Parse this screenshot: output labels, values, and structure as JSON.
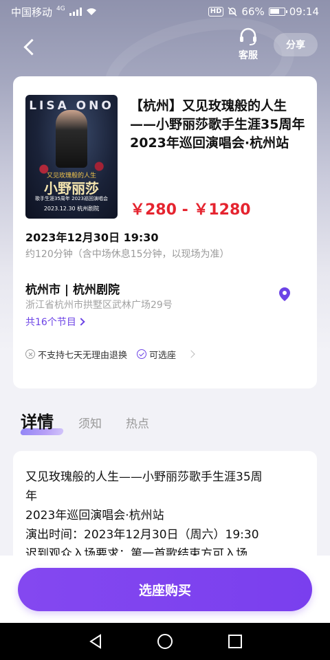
{
  "status_bar": {
    "carrier": "中国移动",
    "network": "4G",
    "hd": "HD",
    "battery": "66%",
    "time": "09:14"
  },
  "nav": {
    "service_label": "客服",
    "share_label": "分享"
  },
  "event": {
    "poster_artist": "LISA ONO",
    "poster_subtitle": "又见玫瑰般的人生",
    "poster_name": "小野丽莎",
    "poster_line": "歌手生涯35周年 2023巡回演唱会",
    "poster_date": "2023.12.30  杭州剧院",
    "title": "【杭州】又见玫瑰般的人生——小野丽莎歌手生涯35周年 2023年巡回演唱会·杭州站",
    "price": "￥280 - ￥1280",
    "date": "2023年12月30日 19:30",
    "duration": "约120分钟（含中场休息15分钟，以现场为准）",
    "venue": "杭州市 | 杭州剧院",
    "address": "浙江省杭州市拱墅区武林广场29号",
    "program_link": "共16个节目",
    "policy_no_refund": "不支持七天无理由退换",
    "policy_seat": "可选座"
  },
  "tabs": [
    "详情",
    "须知",
    "热点"
  ],
  "detail_lines": [
    "又见玫瑰般的人生——小野丽莎歌手生涯35周",
    "年",
    "2023年巡回演唱会·杭州站",
    "演出时间：2023年12月30日（周六）19:30",
    "迟到观众入场要求：第一首歌结束方可入场"
  ],
  "bottom": {
    "buy_label": "选座购买"
  },
  "colors": {
    "accent": "#7a3fee",
    "price": "#e5242f",
    "link": "#6c43e6"
  }
}
